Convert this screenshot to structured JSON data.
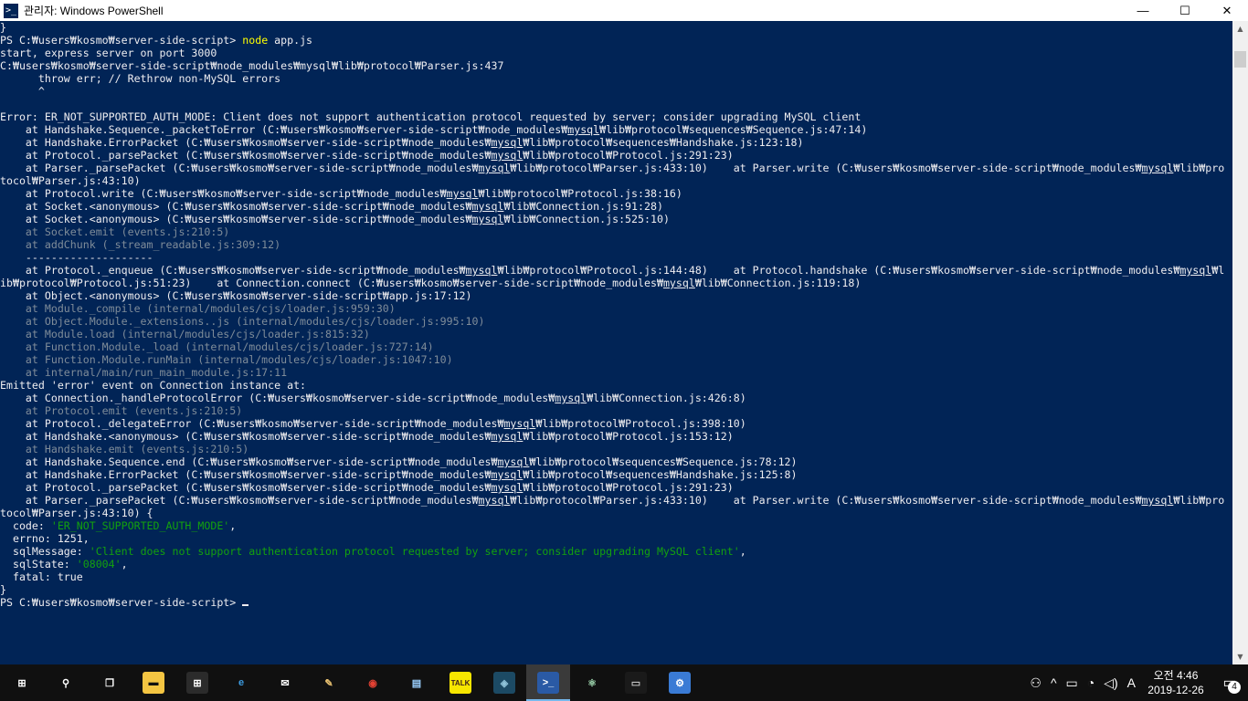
{
  "window": {
    "title": "관리자: Windows PowerShell",
    "icon": "powershell-icon"
  },
  "console": {
    "lines": [
      [
        {
          "t": "}"
        }
      ],
      [
        {
          "t": "PS C:₩users₩kosmo₩server-side-script> "
        },
        {
          "t": "node",
          "c": "cmd"
        },
        {
          "t": " app.js"
        }
      ],
      [
        {
          "t": "start, express server on port 3000"
        }
      ],
      [
        {
          "t": "C:₩users₩kosmo₩server-side-script₩node_modules₩mysql₩lib₩protocol₩Parser.js:437"
        }
      ],
      [
        {
          "t": "      throw err; // Rethrow non-MySQL errors"
        }
      ],
      [
        {
          "t": "      ^"
        }
      ],
      [
        {
          "t": ""
        }
      ],
      [
        {
          "t": "Error: ER_NOT_SUPPORTED_AUTH_MODE: Client does not support authentication protocol requested by server; consider upgrading MySQL client"
        }
      ],
      [
        {
          "t": "    at Handshake.Sequence._packetToError (C:₩users₩kosmo₩server-side-script₩node_modules₩"
        },
        {
          "t": "mysql",
          "c": "ul"
        },
        {
          "t": "₩lib₩protocol₩sequences₩Sequence.js:47:14)"
        }
      ],
      [
        {
          "t": "    at Handshake.ErrorPacket (C:₩users₩kosmo₩server-side-script₩node_modules₩"
        },
        {
          "t": "mysql",
          "c": "ul"
        },
        {
          "t": "₩lib₩protocol₩sequences₩Handshake.js:123:18)"
        }
      ],
      [
        {
          "t": "    at Protocol._parsePacket (C:₩users₩kosmo₩server-side-script₩node_modules₩"
        },
        {
          "t": "mysql",
          "c": "ul"
        },
        {
          "t": "₩lib₩protocol₩Protocol.js:291:23)"
        }
      ],
      [
        {
          "t": "    at Parser._parsePacket (C:₩users₩kosmo₩server-side-script₩node_modules₩"
        },
        {
          "t": "mysql",
          "c": "ul"
        },
        {
          "t": "₩lib₩protocol₩Parser.js:433:10)    at Parser.write (C:₩users₩kosmo₩server-side-script₩node_modules₩"
        },
        {
          "t": "mysql",
          "c": "ul"
        },
        {
          "t": "₩lib₩pro"
        }
      ],
      [
        {
          "t": "tocol₩Parser.js:43:10)"
        }
      ],
      [
        {
          "t": "    at Protocol.write (C:₩users₩kosmo₩server-side-script₩node_modules₩"
        },
        {
          "t": "mysql",
          "c": "ul"
        },
        {
          "t": "₩lib₩protocol₩Protocol.js:38:16)"
        }
      ],
      [
        {
          "t": "    at Socket.<anonymous> (C:₩users₩kosmo₩server-side-script₩node_modules₩"
        },
        {
          "t": "mysql",
          "c": "ul"
        },
        {
          "t": "₩lib₩Connection.js:91:28)"
        }
      ],
      [
        {
          "t": "    at Socket.<anonymous> (C:₩users₩kosmo₩server-side-script₩node_modules₩"
        },
        {
          "t": "mysql",
          "c": "ul"
        },
        {
          "t": "₩lib₩Connection.js:525:10)"
        }
      ],
      [
        {
          "t": "    at Socket.emit (events.js:210:5)",
          "c": "dim"
        }
      ],
      [
        {
          "t": "    at addChunk (_stream_readable.js:309:12)",
          "c": "dim"
        }
      ],
      [
        {
          "t": "    --------------------"
        }
      ],
      [
        {
          "t": "    at Protocol._enqueue (C:₩users₩kosmo₩server-side-script₩node_modules₩"
        },
        {
          "t": "mysql",
          "c": "ul"
        },
        {
          "t": "₩lib₩protocol₩Protocol.js:144:48)    at Protocol.handshake (C:₩users₩kosmo₩server-side-script₩node_modules₩"
        },
        {
          "t": "mysql",
          "c": "ul"
        },
        {
          "t": "₩l"
        }
      ],
      [
        {
          "t": "ib₩protocol₩Protocol.js:51:23)    at Connection.connect (C:₩users₩kosmo₩server-side-script₩node_modules₩"
        },
        {
          "t": "mysql",
          "c": "ul"
        },
        {
          "t": "₩lib₩Connection.js:119:18)"
        }
      ],
      [
        {
          "t": "    at Object.<anonymous> (C:₩users₩kosmo₩server-side-script₩app.js:17:12)"
        }
      ],
      [
        {
          "t": "    at Module._compile (internal/modules/cjs/loader.js:959:30)",
          "c": "dim"
        }
      ],
      [
        {
          "t": "    at Object.Module._extensions..js (internal/modules/cjs/loader.js:995:10)",
          "c": "dim"
        }
      ],
      [
        {
          "t": "    at Module.load (internal/modules/cjs/loader.js:815:32)",
          "c": "dim"
        }
      ],
      [
        {
          "t": "    at Function.Module._load (internal/modules/cjs/loader.js:727:14)",
          "c": "dim"
        }
      ],
      [
        {
          "t": "    at Function.Module.runMain (internal/modules/cjs/loader.js:1047:10)",
          "c": "dim"
        }
      ],
      [
        {
          "t": "    at internal/main/run_main_module.js:17:11",
          "c": "dim"
        }
      ],
      [
        {
          "t": "Emitted 'error' event on Connection instance at:"
        }
      ],
      [
        {
          "t": "    at Connection._handleProtocolError (C:₩users₩kosmo₩server-side-script₩node_modules₩"
        },
        {
          "t": "mysql",
          "c": "ul"
        },
        {
          "t": "₩lib₩Connection.js:426:8)"
        }
      ],
      [
        {
          "t": "    at Protocol.emit (events.js:210:5)",
          "c": "dim"
        }
      ],
      [
        {
          "t": "    at Protocol._delegateError (C:₩users₩kosmo₩server-side-script₩node_modules₩"
        },
        {
          "t": "mysql",
          "c": "ul"
        },
        {
          "t": "₩lib₩protocol₩Protocol.js:398:10)"
        }
      ],
      [
        {
          "t": "    at Handshake.<anonymous> (C:₩users₩kosmo₩server-side-script₩node_modules₩"
        },
        {
          "t": "mysql",
          "c": "ul"
        },
        {
          "t": "₩lib₩protocol₩Protocol.js:153:12)"
        }
      ],
      [
        {
          "t": "    at Handshake.emit (events.js:210:5)",
          "c": "dim"
        }
      ],
      [
        {
          "t": "    at Handshake.Sequence.end (C:₩users₩kosmo₩server-side-script₩node_modules₩"
        },
        {
          "t": "mysql",
          "c": "ul"
        },
        {
          "t": "₩lib₩protocol₩sequences₩Sequence.js:78:12)"
        }
      ],
      [
        {
          "t": "    at Handshake.ErrorPacket (C:₩users₩kosmo₩server-side-script₩node_modules₩"
        },
        {
          "t": "mysql",
          "c": "ul"
        },
        {
          "t": "₩lib₩protocol₩sequences₩Handshake.js:125:8)"
        }
      ],
      [
        {
          "t": "    at Protocol._parsePacket (C:₩users₩kosmo₩server-side-script₩node_modules₩"
        },
        {
          "t": "mysql",
          "c": "ul"
        },
        {
          "t": "₩lib₩protocol₩Protocol.js:291:23)"
        }
      ],
      [
        {
          "t": "    at Parser._parsePacket (C:₩users₩kosmo₩server-side-script₩node_modules₩"
        },
        {
          "t": "mysql",
          "c": "ul"
        },
        {
          "t": "₩lib₩protocol₩Parser.js:433:10)    at Parser.write (C:₩users₩kosmo₩server-side-script₩node_modules₩"
        },
        {
          "t": "mysql",
          "c": "ul"
        },
        {
          "t": "₩lib₩pro"
        }
      ],
      [
        {
          "t": "tocol₩Parser.js:43:10) {"
        }
      ],
      [
        {
          "t": "  code: "
        },
        {
          "t": "'ER_NOT_SUPPORTED_AUTH_MODE'",
          "c": "green"
        },
        {
          "t": ","
        }
      ],
      [
        {
          "t": "  errno: 1251,"
        }
      ],
      [
        {
          "t": "  sqlMessage: "
        },
        {
          "t": "'Client does not support authentication protocol requested by server; consider upgrading MySQL client'",
          "c": "green"
        },
        {
          "t": ","
        }
      ],
      [
        {
          "t": "  sqlState: "
        },
        {
          "t": "'08004'",
          "c": "green"
        },
        {
          "t": ","
        }
      ],
      [
        {
          "t": "  fatal: true"
        }
      ],
      [
        {
          "t": "}"
        }
      ],
      [
        {
          "t": "PS C:₩users₩kosmo₩server-side-script> "
        }
      ]
    ]
  },
  "titlebar_controls": {
    "minimize": "—",
    "maximize": "☐",
    "close": "✕"
  },
  "taskbar": {
    "apps": [
      {
        "name": "start-button",
        "icon": "windows-logo-icon",
        "glyph": "⊞",
        "color": "#ffffff",
        "bg": "transparent"
      },
      {
        "name": "search-button",
        "icon": "search-icon",
        "glyph": "⚲",
        "color": "#ffffff",
        "bg": "transparent"
      },
      {
        "name": "task-view-button",
        "icon": "task-view-icon",
        "glyph": "❐",
        "color": "#ffffff",
        "bg": "transparent"
      },
      {
        "name": "file-explorer-button",
        "icon": "folder-icon",
        "glyph": "▬",
        "color": "#101010",
        "bg": "#f4c542"
      },
      {
        "name": "store-button",
        "icon": "store-icon",
        "glyph": "⊞",
        "color": "#ffffff",
        "bg": "#2b2b2b"
      },
      {
        "name": "edge-button",
        "icon": "edge-icon",
        "glyph": "e",
        "color": "#3c9be0",
        "bg": "transparent"
      },
      {
        "name": "mail-button",
        "icon": "mail-icon",
        "glyph": "✉",
        "color": "#ffffff",
        "bg": "transparent"
      },
      {
        "name": "paint-button",
        "icon": "paint-icon",
        "glyph": "✎",
        "color": "#e8c070",
        "bg": "transparent"
      },
      {
        "name": "chrome-button",
        "icon": "chrome-icon",
        "glyph": "◉",
        "color": "#e34133",
        "bg": "transparent"
      },
      {
        "name": "notepad-button",
        "icon": "notepad-icon",
        "glyph": "▤",
        "color": "#9bd0ff",
        "bg": "transparent"
      },
      {
        "name": "kakaotalk-button",
        "icon": "kakaotalk-icon",
        "glyph": "TALK",
        "color": "#3a1d1d",
        "bg": "#f7e600"
      },
      {
        "name": "mysql-workbench-button",
        "icon": "mysql-workbench-icon",
        "glyph": "◈",
        "color": "#8fc3d9",
        "bg": "#1c4a64"
      },
      {
        "name": "powershell-button",
        "icon": "powershell-icon",
        "glyph": ">_",
        "color": "#ffffff",
        "bg": "#2a5aa5",
        "active": true
      },
      {
        "name": "atom-button",
        "icon": "atom-icon",
        "glyph": "⚛",
        "color": "#9fd8b0",
        "bg": "transparent"
      },
      {
        "name": "mysql-cli-button",
        "icon": "terminal-icon",
        "glyph": "▭",
        "color": "#c0c0c0",
        "bg": "#1a1a1a"
      },
      {
        "name": "control-panel-button",
        "icon": "control-panel-icon",
        "glyph": "⚙",
        "color": "#ffffff",
        "bg": "#3a7bd5"
      }
    ],
    "tray": {
      "people": "⚇",
      "chevron": "^",
      "battery": "▭",
      "wifi": "◔",
      "volume": "◁)",
      "ime": "A",
      "time": "오전 4:46",
      "date": "2019-12-26",
      "notifications": "4"
    }
  }
}
